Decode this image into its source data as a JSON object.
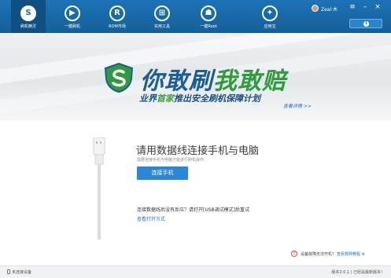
{
  "nav": {
    "items": [
      {
        "label": "刷机精灵",
        "icon": "S"
      },
      {
        "label": "一键刷机",
        "icon": "▶"
      },
      {
        "label": "ROM市场",
        "icon": "R"
      },
      {
        "label": "实用工具",
        "icon": "⊞"
      },
      {
        "label": "一键Root",
        "icon": "☗"
      },
      {
        "label": "应用宝",
        "icon": "✦"
      }
    ]
  },
  "user": {
    "name": "Zeal·木"
  },
  "window": {
    "menu": "≡",
    "minimize": "–",
    "close": "×"
  },
  "update": {
    "icon": "⬇"
  },
  "banner": {
    "title_a": "你敢刷",
    "title_b": "我敢赔",
    "subtitle_pre": "业界",
    "subtitle_hl": "首家",
    "subtitle_post": "推出安全刷机保障计划",
    "link": "查看详情 >>"
  },
  "connect": {
    "title": "请用数据线连接手机与电脑",
    "desc": "需要连接手机与电脑才能进行刷机操作",
    "button": "连接手机",
    "hint": "连接数据线后没有反应？请打开[USB调试模式]后重试",
    "hint_link": "查看打开方式"
  },
  "warning": {
    "icon": "!",
    "text": "设备故障无法开机？",
    "link": "查看救砖教程 ⊕"
  },
  "status": {
    "left": "未连接设备",
    "right": "版本2.0.1 | 已经是最新版本！"
  },
  "colors": {
    "topbar": "#1c73b6",
    "accent": "#2b87d6",
    "brand_green": "#2f9b3e",
    "warning": "#e04a3a"
  }
}
